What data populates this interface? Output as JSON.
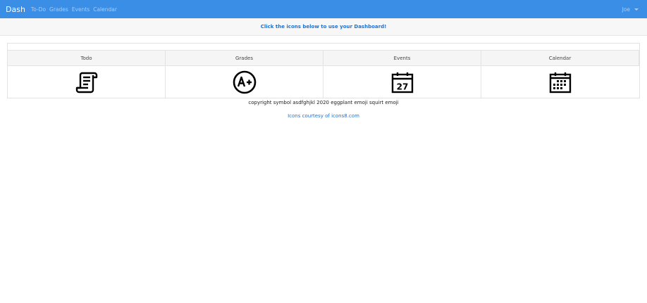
{
  "navbar": {
    "brand": "Dash",
    "links": [
      "To-Do",
      "Grades",
      "Events",
      "Calendar"
    ],
    "user": "Joe"
  },
  "banner": {
    "text": "Click the icons below to use your Dashboard!"
  },
  "dashboard": {
    "columns": [
      {
        "label": "Todo",
        "icon": "scroll-icon"
      },
      {
        "label": "Grades",
        "icon": "grade-a-plus-icon"
      },
      {
        "label": "Events",
        "icon": "calendar-27-icon",
        "icon_text": "27"
      },
      {
        "label": "Calendar",
        "icon": "calendar-grid-icon"
      }
    ]
  },
  "footer": {
    "copyright": "copyright symbol asdfghjkl 2020 eggplant emoji squirt emoji",
    "credit": "Icons courtesy of icons8.com"
  },
  "colors": {
    "navbar_bg": "#3a8ee6",
    "accent": "#1a73d9"
  }
}
